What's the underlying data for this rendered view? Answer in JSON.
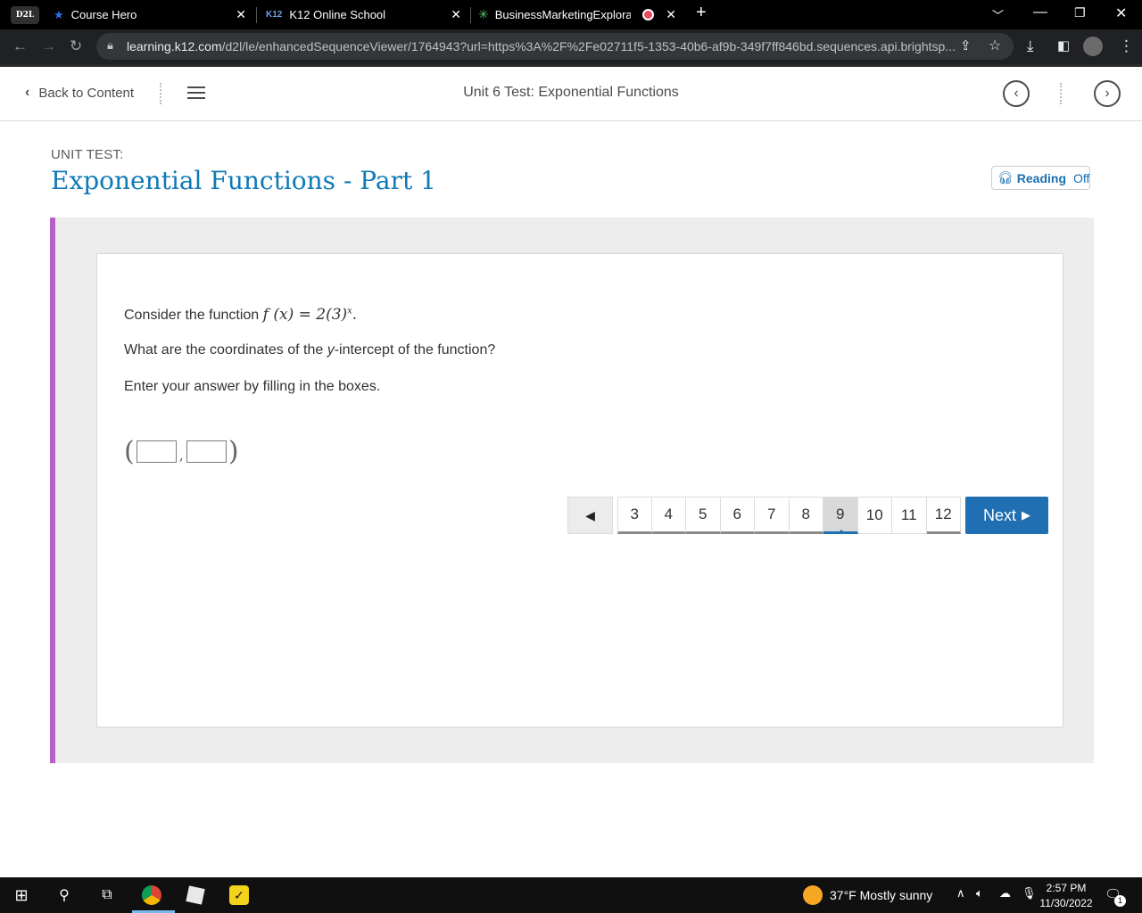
{
  "browser": {
    "tabs": [
      {
        "label": "Course Hero"
      },
      {
        "label": "K12 Online School"
      },
      {
        "label": "BusinessMarketingExploratio"
      }
    ],
    "d2l_badge": "D2L",
    "k12_badge": "K12",
    "url_host": "learning.k12.com",
    "url_path": "/d2l/le/enhancedSequenceViewer/1764943?url=https%3A%2F%2Fe02711f5-1353-40b6-af9b-349f7ff846bd.sequences.api.brightsp..."
  },
  "header": {
    "back_label": "Back to Content",
    "title": "Unit 6 Test: Exponential Functions"
  },
  "content": {
    "unit_label": "UNIT TEST:",
    "unit_title": "Exponential Functions - Part 1",
    "reading_label": "Reading",
    "reading_state": "Off"
  },
  "question": {
    "line1_prefix": "Consider the function",
    "line1_math": "f (x) = 2(3)",
    "line1_exp": "x",
    "line2_pre": "What are the coordinates of the ",
    "line2_var": "y",
    "line2_post": "-intercept of the function?",
    "line3": "Enter your answer by filling in the boxes."
  },
  "pagination": {
    "pages": [
      "3",
      "4",
      "5",
      "6",
      "7",
      "8",
      "9",
      "10",
      "11",
      "12"
    ],
    "current": "9",
    "next_label": "Next"
  },
  "taskbar": {
    "weather": "37°F  Mostly sunny",
    "time": "2:57 PM",
    "date": "11/30/2022",
    "notif_count": "1"
  }
}
